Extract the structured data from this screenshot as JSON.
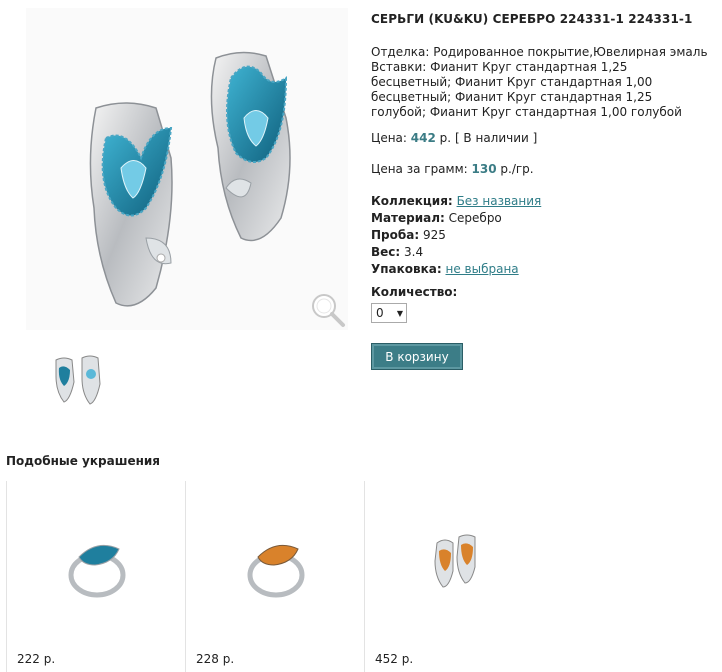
{
  "product": {
    "title": "СЕРЬГИ (KU&KU) СЕРЕБРО 224331-1 224331-1",
    "finish_line": "Отделка: Родированное покрытие,Ювелирная эмаль",
    "inserts_line": "Вставки: Фианит Круг стандартная 1,25 бесцветный; Фианит Круг стандартная 1,00 бесцветный; Фианит Круг стандартная 1,25 голубой; Фианит Круг стандартная 1,00 голубой",
    "price_label": "Цена:",
    "price_value": "442",
    "price_unit": "р.",
    "availability": "[ В наличии ]",
    "per_gram_label": "Цена за грамм:",
    "per_gram_value": "130",
    "per_gram_unit": "р./гр.",
    "collection_label": "Коллекция:",
    "collection_value": "Без названия",
    "material_label": "Материал:",
    "material_value": "Серебро",
    "purity_label": "Проба:",
    "purity_value": "925",
    "weight_label": "Вес:",
    "weight_value": "3.4",
    "packaging_label": "Упаковка:",
    "packaging_value": "не выбрана",
    "quantity_label": "Количество:",
    "quantity_value": "0",
    "cart_button": "В корзину"
  },
  "icons": {
    "zoom": "magnifier-icon",
    "dropdown": "chevron-down-icon"
  },
  "colors": {
    "accent": "#3c7d87",
    "enamel_blue": "#1f7f9e",
    "enamel_orange": "#d9822b"
  },
  "similar": {
    "heading": "Подобные украшения",
    "items": [
      {
        "price": "222 р."
      },
      {
        "price": "228 р."
      },
      {
        "price": "452 р."
      }
    ]
  }
}
